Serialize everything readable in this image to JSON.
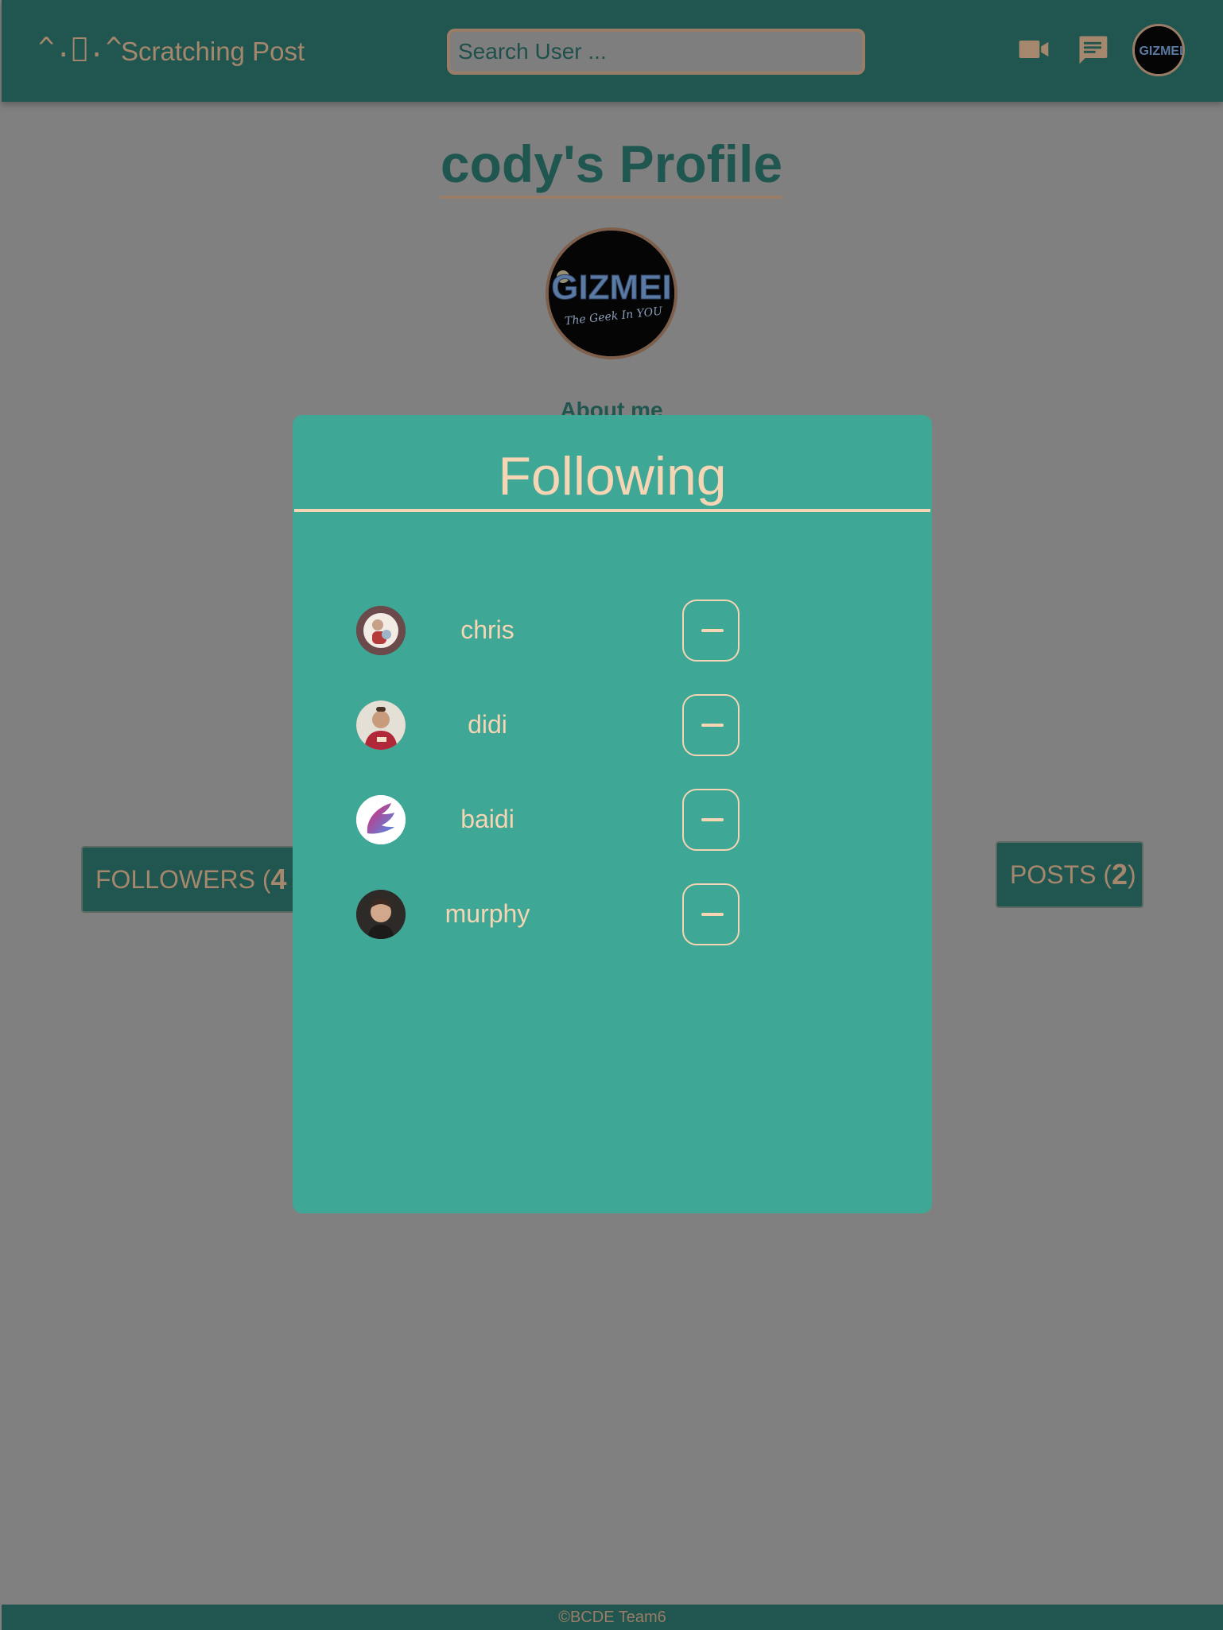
{
  "navbar": {
    "logo_text": "^.ﾟ.^",
    "brand_name": "Scratching Post",
    "search_placeholder": "Search User ...",
    "icons": [
      "video-camera-icon",
      "chat-icon"
    ],
    "avatar_image": "GIZMEI"
  },
  "profile": {
    "title": "cody's Profile",
    "avatar_text": "GIZMEI",
    "avatar_tagline": "The Geek In YOU",
    "about_label": "About me",
    "followers_label": "FOLLOWERS (",
    "followers_count": "4",
    "posts_label": "POSTS (",
    "posts_count": "2",
    "posts_close": ")"
  },
  "modal": {
    "title": "Following",
    "users": [
      {
        "name": "chris"
      },
      {
        "name": "didi"
      },
      {
        "name": "baidi"
      },
      {
        "name": "murphy"
      }
    ]
  },
  "colors": {
    "navbar": "#205550",
    "modal": "#3fa795",
    "accent_text": "#f5d5b4",
    "muted_brown": "#a4876c",
    "overlay_gray": "#808080"
  },
  "footer": {
    "text": "©BCDE Team6"
  }
}
